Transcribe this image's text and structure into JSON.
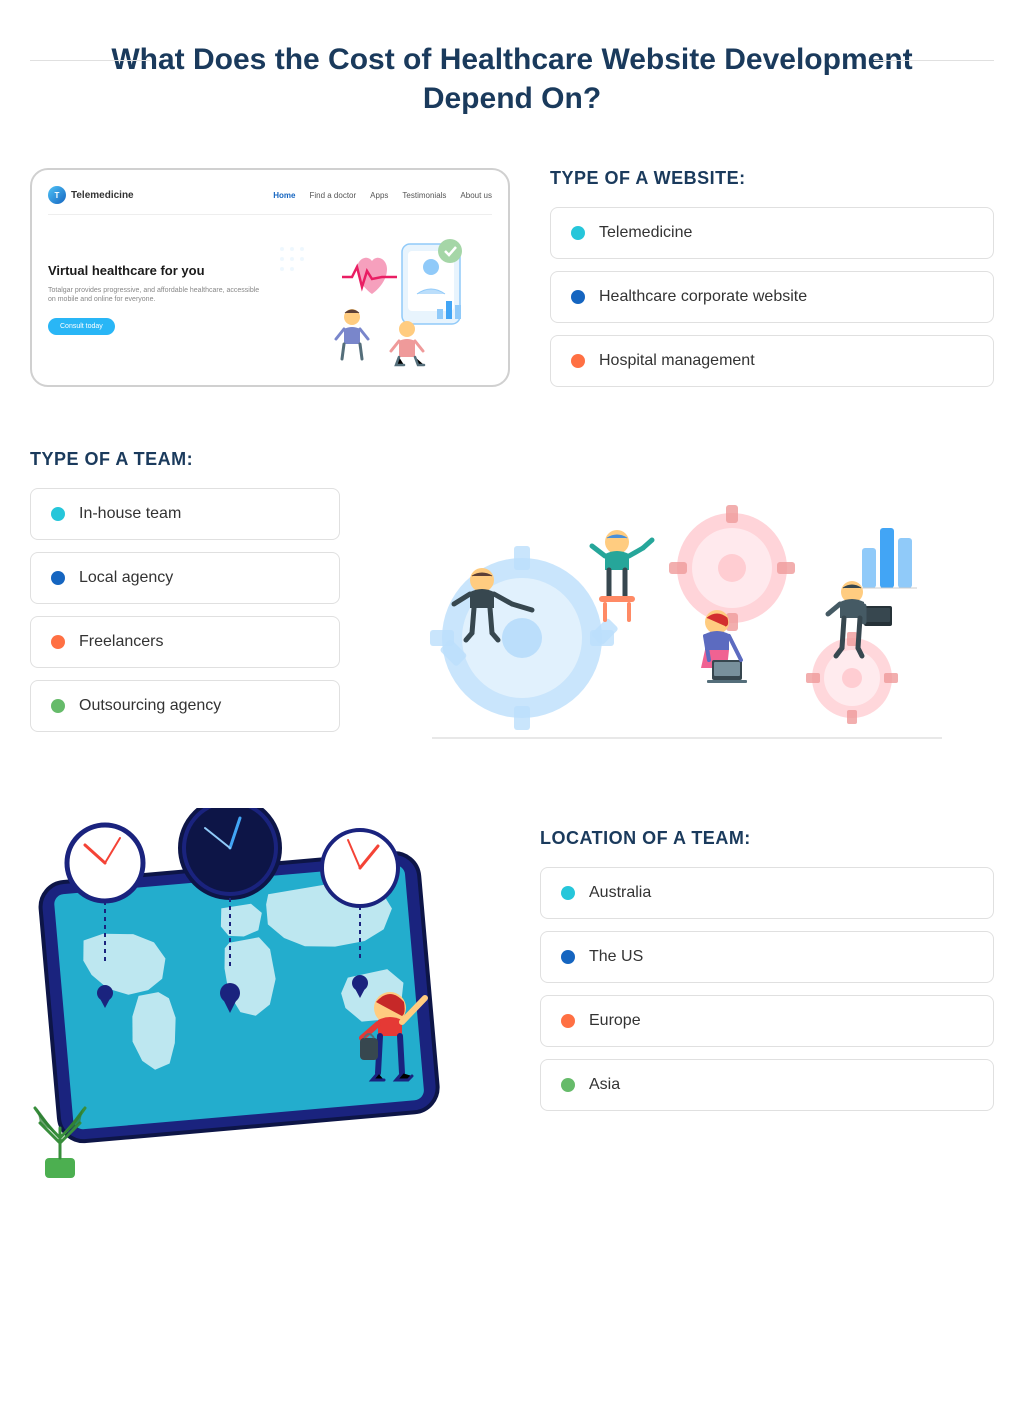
{
  "header": {
    "title": "What Does the Cost of Healthcare Website Development Depend On?"
  },
  "mockup": {
    "logo_letter": "T",
    "logo_text": "Telemedicine",
    "nav_links": [
      "Home",
      "Find a doctor",
      "Apps",
      "Testimonials",
      "About us"
    ],
    "headline": "Virtual healthcare for you",
    "description": "Totalgar provides progressive, and affordable healthcare, accessible on mobile and online for everyone.",
    "button_label": "Consult today"
  },
  "website_type": {
    "label": "TYPE OF A WEBSITE:",
    "items": [
      {
        "text": "Telemedicine",
        "dot_class": "teal"
      },
      {
        "text": "Healthcare corporate website",
        "dot_class": "blue"
      },
      {
        "text": "Hospital management",
        "dot_class": "orange"
      }
    ]
  },
  "team_type": {
    "label": "TYPE OF A TEAM:",
    "items": [
      {
        "text": "In-house team",
        "dot_class": "teal"
      },
      {
        "text": "Local agency",
        "dot_class": "blue"
      },
      {
        "text": "Freelancers",
        "dot_class": "orange"
      },
      {
        "text": "Outsourcing agency",
        "dot_class": "green"
      }
    ]
  },
  "location": {
    "label": "LOCATION OF A TEAM:",
    "items": [
      {
        "text": "Australia",
        "dot_class": "teal"
      },
      {
        "text": "The US",
        "dot_class": "blue"
      },
      {
        "text": "Europe",
        "dot_class": "orange"
      },
      {
        "text": "Asia",
        "dot_class": "green"
      }
    ]
  }
}
